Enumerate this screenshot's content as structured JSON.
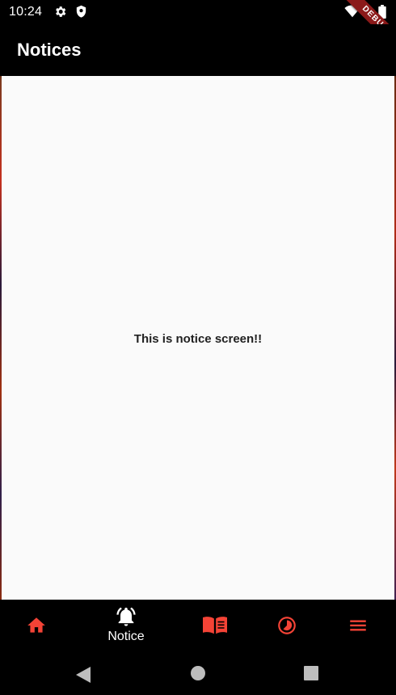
{
  "status_bar": {
    "time": "10:24",
    "icons": [
      "gear-icon",
      "shield-icon",
      "wifi-icon",
      "signal-icon",
      "battery-icon"
    ]
  },
  "debug_ribbon": {
    "label": "DEBUG"
  },
  "app_bar": {
    "title": "Notices"
  },
  "content": {
    "message": "This is notice screen!!"
  },
  "bottom_nav": {
    "accent_color": "#f44336",
    "active_color": "#ffffff",
    "items": [
      {
        "icon": "home-icon",
        "label": "",
        "active": false
      },
      {
        "icon": "notification-bell-icon",
        "label": "Notice",
        "active": true
      },
      {
        "icon": "book-icon",
        "label": "",
        "active": false
      },
      {
        "icon": "timelapse-icon",
        "label": "",
        "active": false
      },
      {
        "icon": "menu-icon",
        "label": "",
        "active": false
      }
    ]
  },
  "system_nav": {
    "buttons": [
      "back-icon",
      "home-circle-icon",
      "recents-icon"
    ]
  }
}
